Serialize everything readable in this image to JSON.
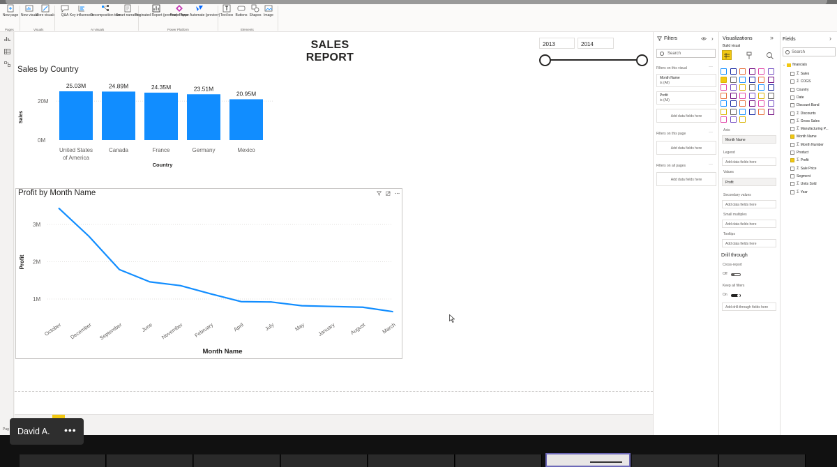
{
  "ribbon": {
    "buttons": [
      {
        "id": "new-page",
        "label": "New page",
        "sub": "⌄"
      },
      {
        "id": "new-visual",
        "label": "New visual"
      },
      {
        "id": "more-visuals",
        "label": "More visuals",
        "sub": "⌄"
      },
      {
        "id": "qa",
        "label": "Q&A"
      },
      {
        "id": "key-influencers",
        "label": "Key influencers"
      },
      {
        "id": "decomposition-tree",
        "label": "Decomposition tree"
      },
      {
        "id": "smart-narrative",
        "label": "Smart narrative"
      },
      {
        "id": "paginated-report",
        "label": "Paginated Report (preview)"
      },
      {
        "id": "power-apps",
        "label": "Power Apps"
      },
      {
        "id": "power-automate",
        "label": "Power Automate (preview)"
      },
      {
        "id": "text-box",
        "label": "Text box"
      },
      {
        "id": "buttons",
        "label": "Buttons"
      },
      {
        "id": "shapes",
        "label": "Shapes"
      },
      {
        "id": "image",
        "label": "Image"
      }
    ],
    "groups": [
      "Pages",
      "Visuals",
      "AI visuals",
      "Power Platform",
      "Elements"
    ]
  },
  "report": {
    "title": "SALES REPORT",
    "year_start": "2013",
    "year_end": "2014"
  },
  "bar_visual": {
    "title": "Sales by Country",
    "xlabel": "Country",
    "ylabel": "Sales",
    "ticks": [
      "20M",
      "0M"
    ]
  },
  "line_visual": {
    "title": "Profit by Month Name",
    "xlabel": "Month Name",
    "ylabel": "Profit",
    "ticks": [
      "3M",
      "2M",
      "1M"
    ]
  },
  "chart_data": [
    {
      "type": "bar",
      "title": "Sales by Country",
      "xlabel": "Country",
      "ylabel": "Sales",
      "categories": [
        "United States of America",
        "Canada",
        "France",
        "Germany",
        "Mexico"
      ],
      "values": [
        25.03,
        24.89,
        24.35,
        23.51,
        20.95
      ],
      "value_labels": [
        "25.03M",
        "24.89M",
        "24.35M",
        "23.51M",
        "20.95M"
      ],
      "unit": "M",
      "ylim": [
        0,
        25.03
      ],
      "color": "#118dff"
    },
    {
      "type": "line",
      "title": "Profit by Month Name",
      "xlabel": "Month Name",
      "ylabel": "Profit",
      "categories": [
        "October",
        "December",
        "September",
        "June",
        "November",
        "February",
        "April",
        "July",
        "May",
        "January",
        "August",
        "March"
      ],
      "values": [
        3.44,
        2.68,
        1.79,
        1.46,
        1.36,
        1.14,
        0.93,
        0.92,
        0.82,
        0.8,
        0.78,
        0.66
      ],
      "unit": "M",
      "ylim": [
        0.5,
        3.5
      ],
      "color": "#118dff"
    }
  ],
  "filters_pane": {
    "title": "Filters",
    "search": "Search",
    "on_visual": "Filters on this visual",
    "cards": [
      {
        "name": "Month Name",
        "value": "is (All)"
      },
      {
        "name": "Profit",
        "value": "is (All)"
      }
    ],
    "add_here": "Add data fields here",
    "on_page": "Filters on this page",
    "on_all": "Filters on all pages"
  },
  "viz_pane": {
    "title": "Visualizations",
    "subtitle": "Build visual",
    "wells": {
      "axis_label": "Axis",
      "axis_value": "Month Name",
      "legend_label": "Legend",
      "legend_value": "Add data fields here",
      "values_label": "Values",
      "values_value": "Profit",
      "secondary_label": "Secondary values",
      "secondary_value": "Add data fields here",
      "small_label": "Small multiples",
      "small_value": "Add data fields here",
      "tooltips_label": "Tooltips",
      "tooltips_value": "Add data fields here"
    },
    "drill": {
      "title": "Drill through",
      "cross": "Cross-report",
      "cross_state": "Off",
      "keep": "Keep all filters",
      "keep_state": "On",
      "add": "Add drill-through fields here"
    }
  },
  "fields_pane": {
    "title": "Fields",
    "search": "Search",
    "table": "financials",
    "items": [
      {
        "label": "Sales",
        "sigma": true,
        "checked": false
      },
      {
        "label": "COGS",
        "sigma": true,
        "checked": false
      },
      {
        "label": "Country",
        "sigma": false,
        "checked": false
      },
      {
        "label": "Date",
        "sigma": false,
        "checked": false
      },
      {
        "label": "Discount Band",
        "sigma": false,
        "checked": false
      },
      {
        "label": "Discounts",
        "sigma": true,
        "checked": false
      },
      {
        "label": "Gross Sales",
        "sigma": true,
        "checked": false
      },
      {
        "label": "Manufacturing P...",
        "sigma": true,
        "checked": false
      },
      {
        "label": "Month Name",
        "sigma": false,
        "checked": true
      },
      {
        "label": "Month Number",
        "sigma": true,
        "checked": false
      },
      {
        "label": "Product",
        "sigma": false,
        "checked": false
      },
      {
        "label": "Profit",
        "sigma": true,
        "checked": true
      },
      {
        "label": "Sale Price",
        "sigma": true,
        "checked": false
      },
      {
        "label": "Segment",
        "sigma": false,
        "checked": false
      },
      {
        "label": "Units Sold",
        "sigma": true,
        "checked": false
      },
      {
        "label": "Year",
        "sigma": true,
        "checked": false
      }
    ]
  },
  "pagebar": {
    "label": "Pag"
  },
  "participant": {
    "name": "David A.",
    "menu": "•••"
  },
  "colors": {
    "accent": "#118dff",
    "brand_yellow": "#f2c811"
  }
}
